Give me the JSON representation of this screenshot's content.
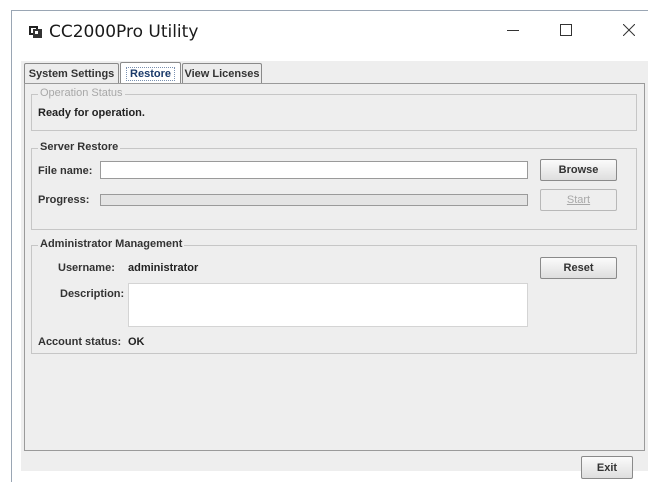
{
  "window": {
    "title": "CC2000Pro Utility",
    "app_icon": "app-icon"
  },
  "tabs": [
    {
      "label": "System Settings"
    },
    {
      "label": "Restore"
    },
    {
      "label": "View Licenses"
    }
  ],
  "active_tab": "Restore",
  "operation_status": {
    "legend": "Operation Status",
    "text": "Ready for operation."
  },
  "server_restore": {
    "legend": "Server Restore",
    "file_name_label": "File name:",
    "file_name_value": "",
    "progress_label": "Progress:",
    "progress": 0,
    "browse_label": "Browse",
    "start_label": "Start"
  },
  "admin": {
    "legend": "Administrator Management",
    "username_label": "Username:",
    "username_value": "administrator",
    "description_label": "Description:",
    "description_value": "",
    "account_status_label": "Account status:",
    "account_status_value": "OK",
    "reset_label": "Reset"
  },
  "footer": {
    "exit_label": "Exit"
  }
}
